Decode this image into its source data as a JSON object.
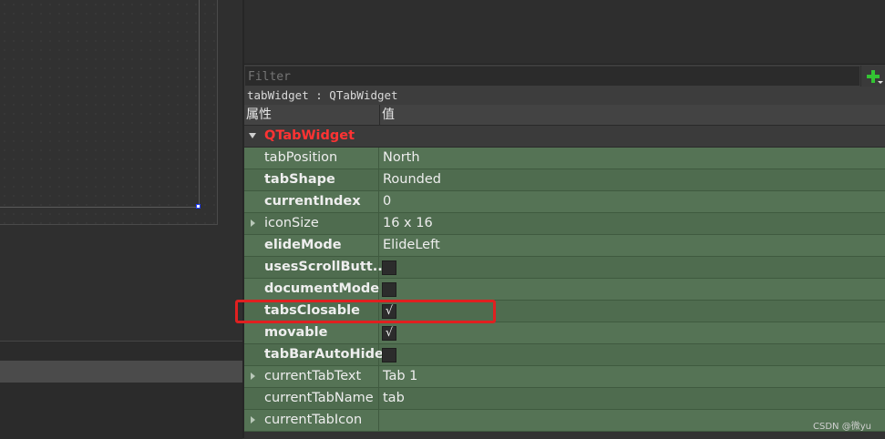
{
  "filter": {
    "placeholder": "Filter"
  },
  "object_label": "tabWidget : QTabWidget",
  "table_header": {
    "property": "属性",
    "value": "值"
  },
  "group": {
    "label": "QTabWidget",
    "color": "#ff3333"
  },
  "rows": [
    {
      "name": "tabPosition",
      "bold": false,
      "expandable": false,
      "type": "text",
      "value": "North"
    },
    {
      "name": "tabShape",
      "bold": true,
      "expandable": false,
      "type": "text",
      "value": "Rounded"
    },
    {
      "name": "currentIndex",
      "bold": true,
      "expandable": false,
      "type": "text",
      "value": "0"
    },
    {
      "name": "iconSize",
      "bold": false,
      "expandable": true,
      "type": "text",
      "value": "16 x 16"
    },
    {
      "name": "elideMode",
      "bold": true,
      "expandable": false,
      "type": "text",
      "value": "ElideLeft"
    },
    {
      "name": "usesScrollButt...",
      "bold": true,
      "expandable": false,
      "type": "checkbox",
      "checked": false
    },
    {
      "name": "documentMode",
      "bold": true,
      "expandable": false,
      "type": "checkbox",
      "checked": false
    },
    {
      "name": "tabsClosable",
      "bold": true,
      "expandable": false,
      "type": "checkbox",
      "checked": true
    },
    {
      "name": "movable",
      "bold": true,
      "expandable": false,
      "type": "checkbox",
      "checked": true
    },
    {
      "name": "tabBarAutoHide",
      "bold": true,
      "expandable": false,
      "type": "checkbox",
      "checked": false
    },
    {
      "name": "currentTabText",
      "bold": false,
      "expandable": true,
      "type": "text",
      "value": "Tab 1"
    },
    {
      "name": "currentTabName",
      "bold": false,
      "expandable": false,
      "type": "text",
      "value": "tab"
    },
    {
      "name": "currentTabIcon",
      "bold": false,
      "expandable": true,
      "type": "text",
      "value": ""
    }
  ],
  "check_glyph": "√",
  "highlighted_row": "tabsClosable",
  "highlight_color": "#e02020",
  "row_color": "#557355",
  "watermark": "CSDN @微yu"
}
